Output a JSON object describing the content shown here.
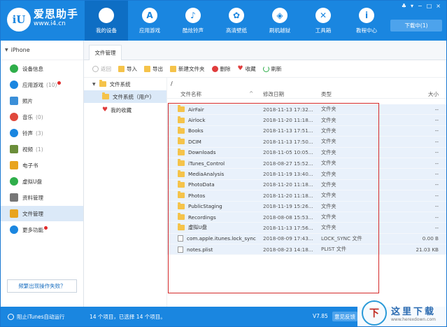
{
  "brand": {
    "logo": "iU",
    "name": "爱思助手",
    "url": "www.i4.cn"
  },
  "nav": [
    {
      "label": "我的设备",
      "icon": "apple-icon",
      "glyph": ""
    },
    {
      "label": "应用游戏",
      "icon": "app-store-icon",
      "glyph": "A"
    },
    {
      "label": "酷炫铃声",
      "icon": "bell-icon",
      "glyph": "♪"
    },
    {
      "label": "高清壁纸",
      "icon": "flower-icon",
      "glyph": "✿"
    },
    {
      "label": "刷机越狱",
      "icon": "box-icon",
      "glyph": "◈"
    },
    {
      "label": "工具箱",
      "icon": "tools-icon",
      "glyph": "✕"
    },
    {
      "label": "教程中心",
      "icon": "info-icon",
      "glyph": "i"
    }
  ],
  "window_controls": [
    "♣",
    "▾",
    "−",
    "□",
    "×"
  ],
  "download_label": "下载中(1)",
  "device": {
    "name": "iPhone"
  },
  "sidebar": {
    "items": [
      {
        "label": "设备信息",
        "icon": "info-circle-icon",
        "color": "#2fae4a",
        "count": ""
      },
      {
        "label": "应用游戏",
        "icon": "app-store-icon",
        "color": "#1a86e0",
        "count": "(10)",
        "dot": true
      },
      {
        "label": "照片",
        "icon": "photo-icon",
        "color": "#3b8fd8",
        "count": ""
      },
      {
        "label": "音乐",
        "icon": "music-icon",
        "color": "#e0483c",
        "count": "(0)"
      },
      {
        "label": "铃声",
        "icon": "bell-icon",
        "color": "#1a86e0",
        "count": "(3)"
      },
      {
        "label": "视频",
        "icon": "video-icon",
        "color": "#6b8e3a",
        "count": "(1)"
      },
      {
        "label": "电子书",
        "icon": "book-icon",
        "color": "#e8a41e",
        "count": ""
      },
      {
        "label": "虚拟U盘",
        "icon": "usb-icon",
        "color": "#2fae4a",
        "count": ""
      },
      {
        "label": "资料管理",
        "icon": "document-icon",
        "color": "#777777",
        "count": ""
      },
      {
        "label": "文件管理",
        "icon": "file-manager-icon",
        "color": "#e8a41e",
        "count": "",
        "active": true
      },
      {
        "label": "更多功能",
        "icon": "grid-icon",
        "color": "#1a86e0",
        "count": "",
        "dot": true
      }
    ],
    "help_button": "频繁出现操作失败？"
  },
  "main": {
    "tab": "文件管理",
    "toolbar": {
      "back": "返回",
      "import": "导入",
      "export": "导出",
      "new_folder": "新建文件夹",
      "delete": "删除",
      "favorite": "收藏",
      "refresh": "刷新"
    },
    "tree": {
      "root": "文件系统",
      "child": "文件系统（用户）",
      "favorites": "我的收藏"
    },
    "path": "/",
    "columns": {
      "name": "文件名称",
      "date": "修改日期",
      "type": "类型",
      "size": "大小"
    },
    "files": [
      {
        "name": "AirFair",
        "date": "2018-11-13 17:32...",
        "type": "文件夹",
        "size": "--",
        "folder": true
      },
      {
        "name": "Airlock",
        "date": "2018-11-20 11:18...",
        "type": "文件夹",
        "size": "--",
        "folder": true
      },
      {
        "name": "Books",
        "date": "2018-11-13 17:51...",
        "type": "文件夹",
        "size": "--",
        "folder": true
      },
      {
        "name": "DCIM",
        "date": "2018-11-13 17:50...",
        "type": "文件夹",
        "size": "--",
        "folder": true
      },
      {
        "name": "Downloads",
        "date": "2018-11-05 10:05...",
        "type": "文件夹",
        "size": "--",
        "folder": true
      },
      {
        "name": "iTunes_Control",
        "date": "2018-08-27 15:52...",
        "type": "文件夹",
        "size": "--",
        "folder": true
      },
      {
        "name": "MediaAnalysis",
        "date": "2018-11-19 13:40...",
        "type": "文件夹",
        "size": "--",
        "folder": true
      },
      {
        "name": "PhotoData",
        "date": "2018-11-20 11:18...",
        "type": "文件夹",
        "size": "--",
        "folder": true
      },
      {
        "name": "Photos",
        "date": "2018-11-20 11:18...",
        "type": "文件夹",
        "size": "--",
        "folder": true
      },
      {
        "name": "PublicStaging",
        "date": "2018-11-19 15:26...",
        "type": "文件夹",
        "size": "--",
        "folder": true
      },
      {
        "name": "Recordings",
        "date": "2018-08-08 15:53...",
        "type": "文件夹",
        "size": "--",
        "folder": true
      },
      {
        "name": "虚拟U盘",
        "date": "2018-11-13 17:56...",
        "type": "文件夹",
        "size": "--",
        "folder": true
      },
      {
        "name": "com.apple.itunes.lock_sync",
        "date": "2018-08-09 17:43...",
        "type": "LOCK_SYNC 文件",
        "size": "0.00 B",
        "folder": false
      },
      {
        "name": "notes.plist",
        "date": "2018-08-23 14:18...",
        "type": "PLIST 文件",
        "size": "21.03 KB",
        "folder": false
      }
    ]
  },
  "status": {
    "itunes": "阻止iTunes自动运行",
    "summary": "14 个项目，已选择 14 个项目。",
    "version": "V7.85",
    "feedback": "意见反馈"
  },
  "watermark": {
    "logo": "下",
    "title": "这里下载",
    "url": "www.herexdown.com"
  }
}
